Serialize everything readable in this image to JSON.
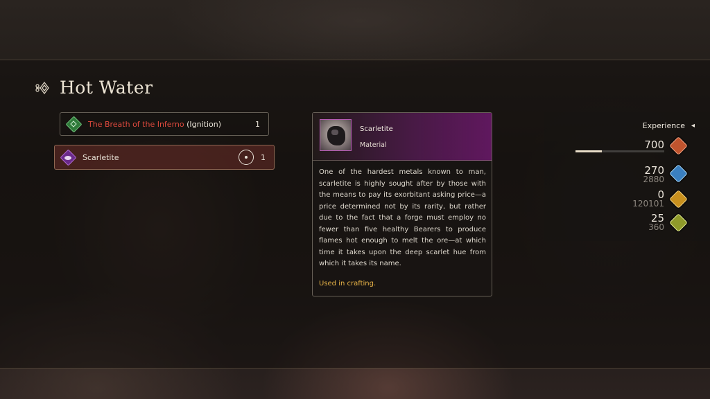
{
  "menu": {
    "title": "Hot Water",
    "title_icon": "ornament-icon"
  },
  "items": [
    {
      "label_red": "The Breath of the Inferno",
      "label_rest": " (Ignition)",
      "quantity": "1",
      "icon": "green-diamond-icon",
      "color": "#2f7a3a"
    },
    {
      "label": "Scarletite",
      "quantity": "1",
      "icon": "purple-diamond-icon",
      "color": "#6a2a8a",
      "selected": true,
      "action_icon": "circle-button-icon"
    }
  ],
  "detail": {
    "name": "Scarletite",
    "type": "Material",
    "description": "One of the hardest metals known to man, scarletite is highly sought after by those with the means to pay its exorbitant asking price—a price determined not by its rarity, but rather due to the fact that a forge must employ no fewer than five healthy Bearers to produce flames hot enough to melt the ore—at which time it takes upon the deep scarlet hue from which it takes its name.",
    "usage": "Used in crafting.",
    "accent": "#8a2a8a"
  },
  "rewards": {
    "label": "Experience",
    "arrow": "◂",
    "experience": {
      "value": "700",
      "bar_fraction": 0.3,
      "icon": "experience-gem-icon",
      "color": "#c0542e"
    },
    "ability_points": {
      "value": "270",
      "total": "2880",
      "icon": "ability-gem-icon",
      "color": "#3a7fc0"
    },
    "gil": {
      "value": "0",
      "total": "120101",
      "icon": "gil-gem-icon",
      "color": "#c8901e"
    },
    "renown": {
      "value": "25",
      "total": "360",
      "icon": "renown-gem-icon",
      "color": "#8f9a2a"
    }
  }
}
